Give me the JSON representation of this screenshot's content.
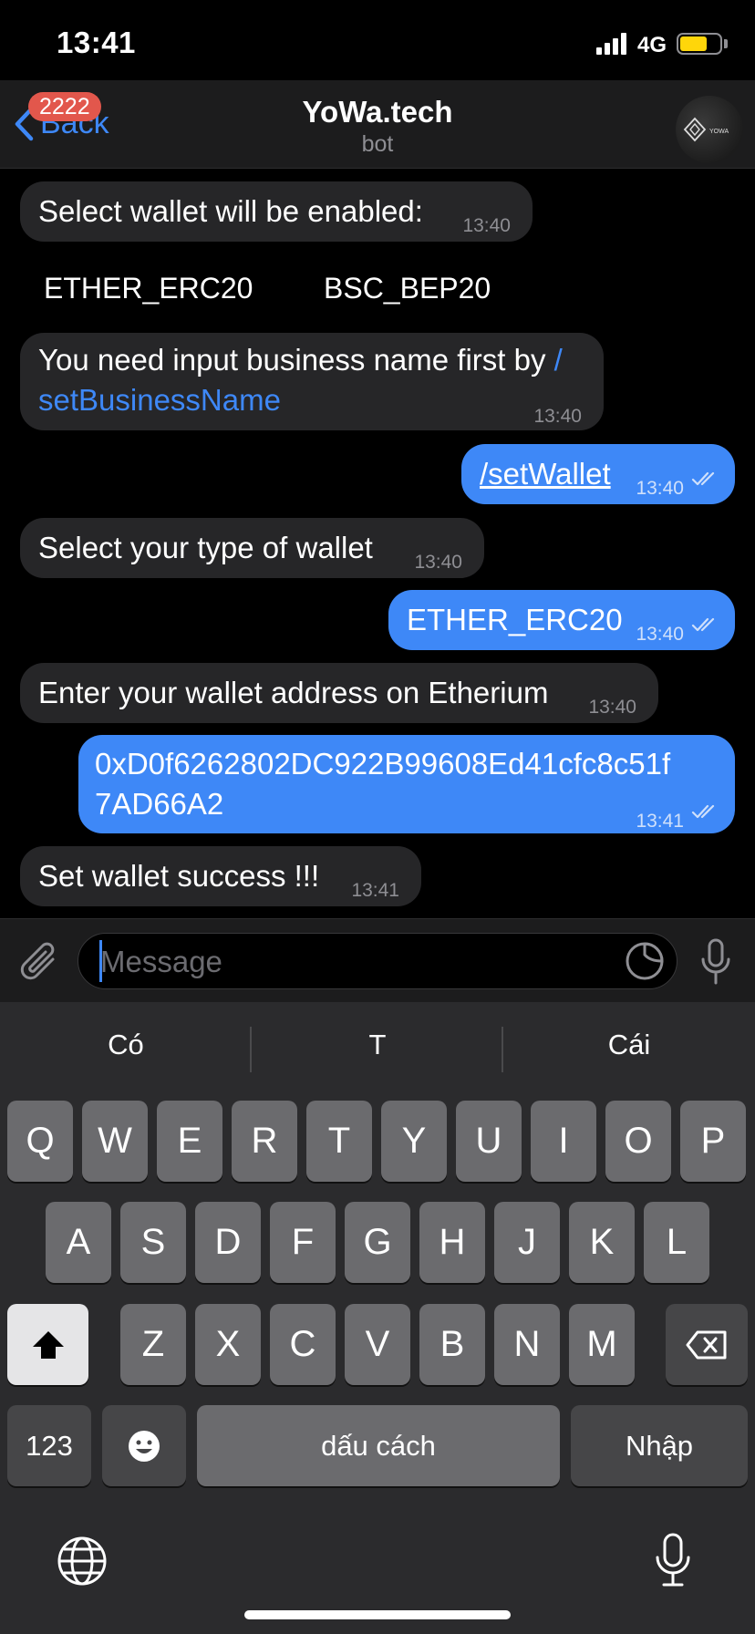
{
  "status_bar": {
    "time": "13:41",
    "network": "4G"
  },
  "header": {
    "back_label": "Back",
    "unread_badge": "2222",
    "title": "YoWa.tech",
    "subtitle": "bot",
    "avatar_text": "YOWA"
  },
  "messages": [
    {
      "text": "Select wallet will be enabled:",
      "time": "13:40"
    },
    {
      "buttons": [
        "ETHER_ERC20",
        "BSC_BEP20"
      ]
    },
    {
      "text_prefix": "You need input business name first by ",
      "link_part1": "/",
      "link_part2": "setBusinessName",
      "time": "13:40"
    },
    {
      "text": "/setWallet",
      "time": "13:40"
    },
    {
      "text": "Select your type of wallet",
      "time": "13:40"
    },
    {
      "text": "ETHER_ERC20",
      "time": "13:40"
    },
    {
      "text": "Enter your wallet address on Etherium",
      "time": "13:40"
    },
    {
      "line1": "0xD0f6262802DC922B99608Ed41cfc8c51f",
      "line2": "7AD66A2",
      "time": "13:41"
    },
    {
      "text": "Set wallet success !!!",
      "time": "13:41"
    }
  ],
  "composer": {
    "placeholder": "Message"
  },
  "keyboard": {
    "suggestions": [
      "Có",
      "T",
      "Cái"
    ],
    "row1": [
      "Q",
      "W",
      "E",
      "R",
      "T",
      "Y",
      "U",
      "I",
      "O",
      "P"
    ],
    "row2": [
      "A",
      "S",
      "D",
      "F",
      "G",
      "H",
      "J",
      "K",
      "L"
    ],
    "row3": [
      "Z",
      "X",
      "C",
      "V",
      "B",
      "N",
      "M"
    ],
    "numbers_label": "123",
    "space_label": "dấu cách",
    "return_label": "Nhập"
  },
  "icons": [
    "signal-icon",
    "battery-icon",
    "back-chevron-icon",
    "attach-icon",
    "sticker-icon",
    "mic-icon",
    "shift-icon",
    "backspace-icon",
    "emoji-icon",
    "globe-icon",
    "dictation-icon",
    "read-receipt-icon"
  ],
  "colors": {
    "accent": "#3e88f7",
    "badge": "#e2574c",
    "incoming_bubble": "#262628",
    "outgoing_bubble": "#3e88f7"
  }
}
